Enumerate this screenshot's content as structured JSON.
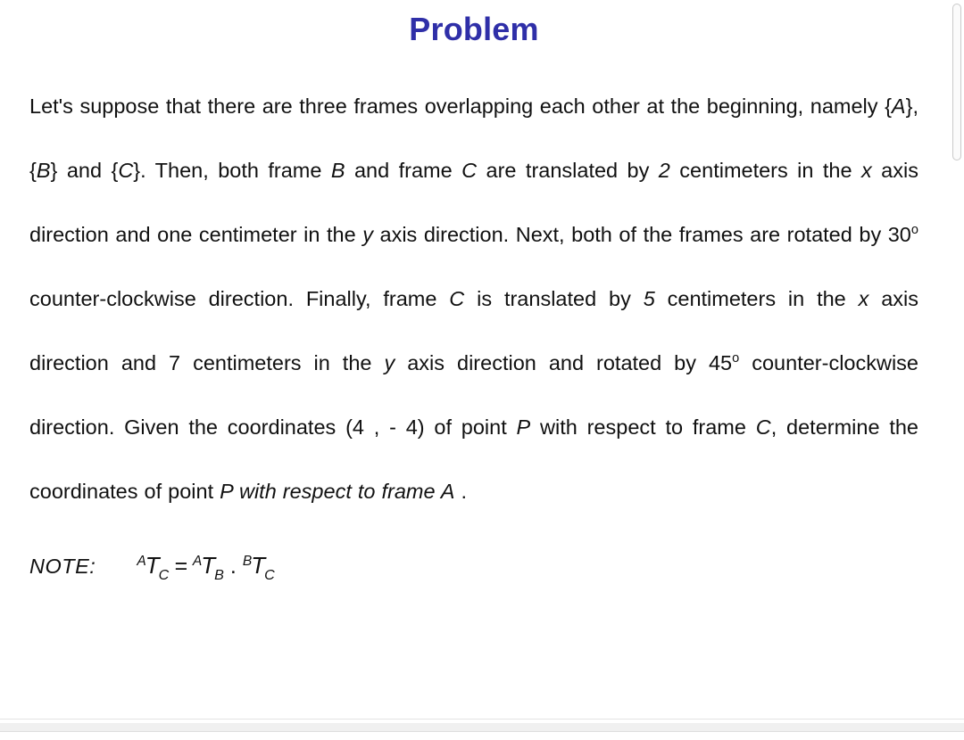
{
  "document": {
    "title": "Problem",
    "title_color": "#2f2fa8",
    "text_color": "#111111",
    "background_color": "#ffffff",
    "body": {
      "seg_1": "Let's suppose that there are three frames overlapping each other at the beginning, namely {",
      "frame_a_1": "A",
      "seg_2": "}, {",
      "frame_b_1": "B",
      "seg_3": "} and {",
      "frame_c_1": "C",
      "seg_4": "}. Then, both frame ",
      "frame_b_2": "B",
      "seg_5": " and frame ",
      "frame_c_2": "C",
      "seg_6": " are translated by ",
      "num_2": "2",
      "seg_7": " centimeters in the ",
      "axis_x_1": "x",
      "seg_8": " axis direction and one centimeter in the ",
      "axis_y_1": "y",
      "seg_9": " axis direction. Next, both of the frames are rotated by 30",
      "deg_30": "o",
      "seg_10": " counter-clockwise direction.  Finally, frame ",
      "frame_c_3": "C",
      "seg_11": " is translated by ",
      "num_5": "5",
      "seg_12": " centimeters in the ",
      "axis_x_2": "x",
      "seg_13": " axis direction and 7 centimeters in the ",
      "axis_y_2": "y",
      "seg_14": " axis direction and rotated by 45",
      "deg_45": "o",
      "seg_15": " counter-clockwise direction. Given the coordinates (4 , - 4) of point ",
      "point_p_1": "P",
      "seg_16": " with respect to frame ",
      "frame_c_4": "C",
      "seg_17": ", determine the coordinates of point ",
      "emph_tail": "P with respect to frame A",
      "seg_18": " ."
    },
    "note": {
      "label": "NOTE:",
      "lhs": {
        "pre": "A",
        "base": "T",
        "post": "C"
      },
      "equals": "=",
      "rhs_1": {
        "pre": "A",
        "base": "T",
        "post": "B"
      },
      "operator": ".",
      "rhs_2": {
        "pre": "B",
        "base": "T",
        "post": "C"
      }
    }
  },
  "chrome": {
    "scrollbar": {
      "orientation": "vertical",
      "thumb_color": "#fbfbfb",
      "thumb_border_color": "#c9c9c9"
    }
  }
}
